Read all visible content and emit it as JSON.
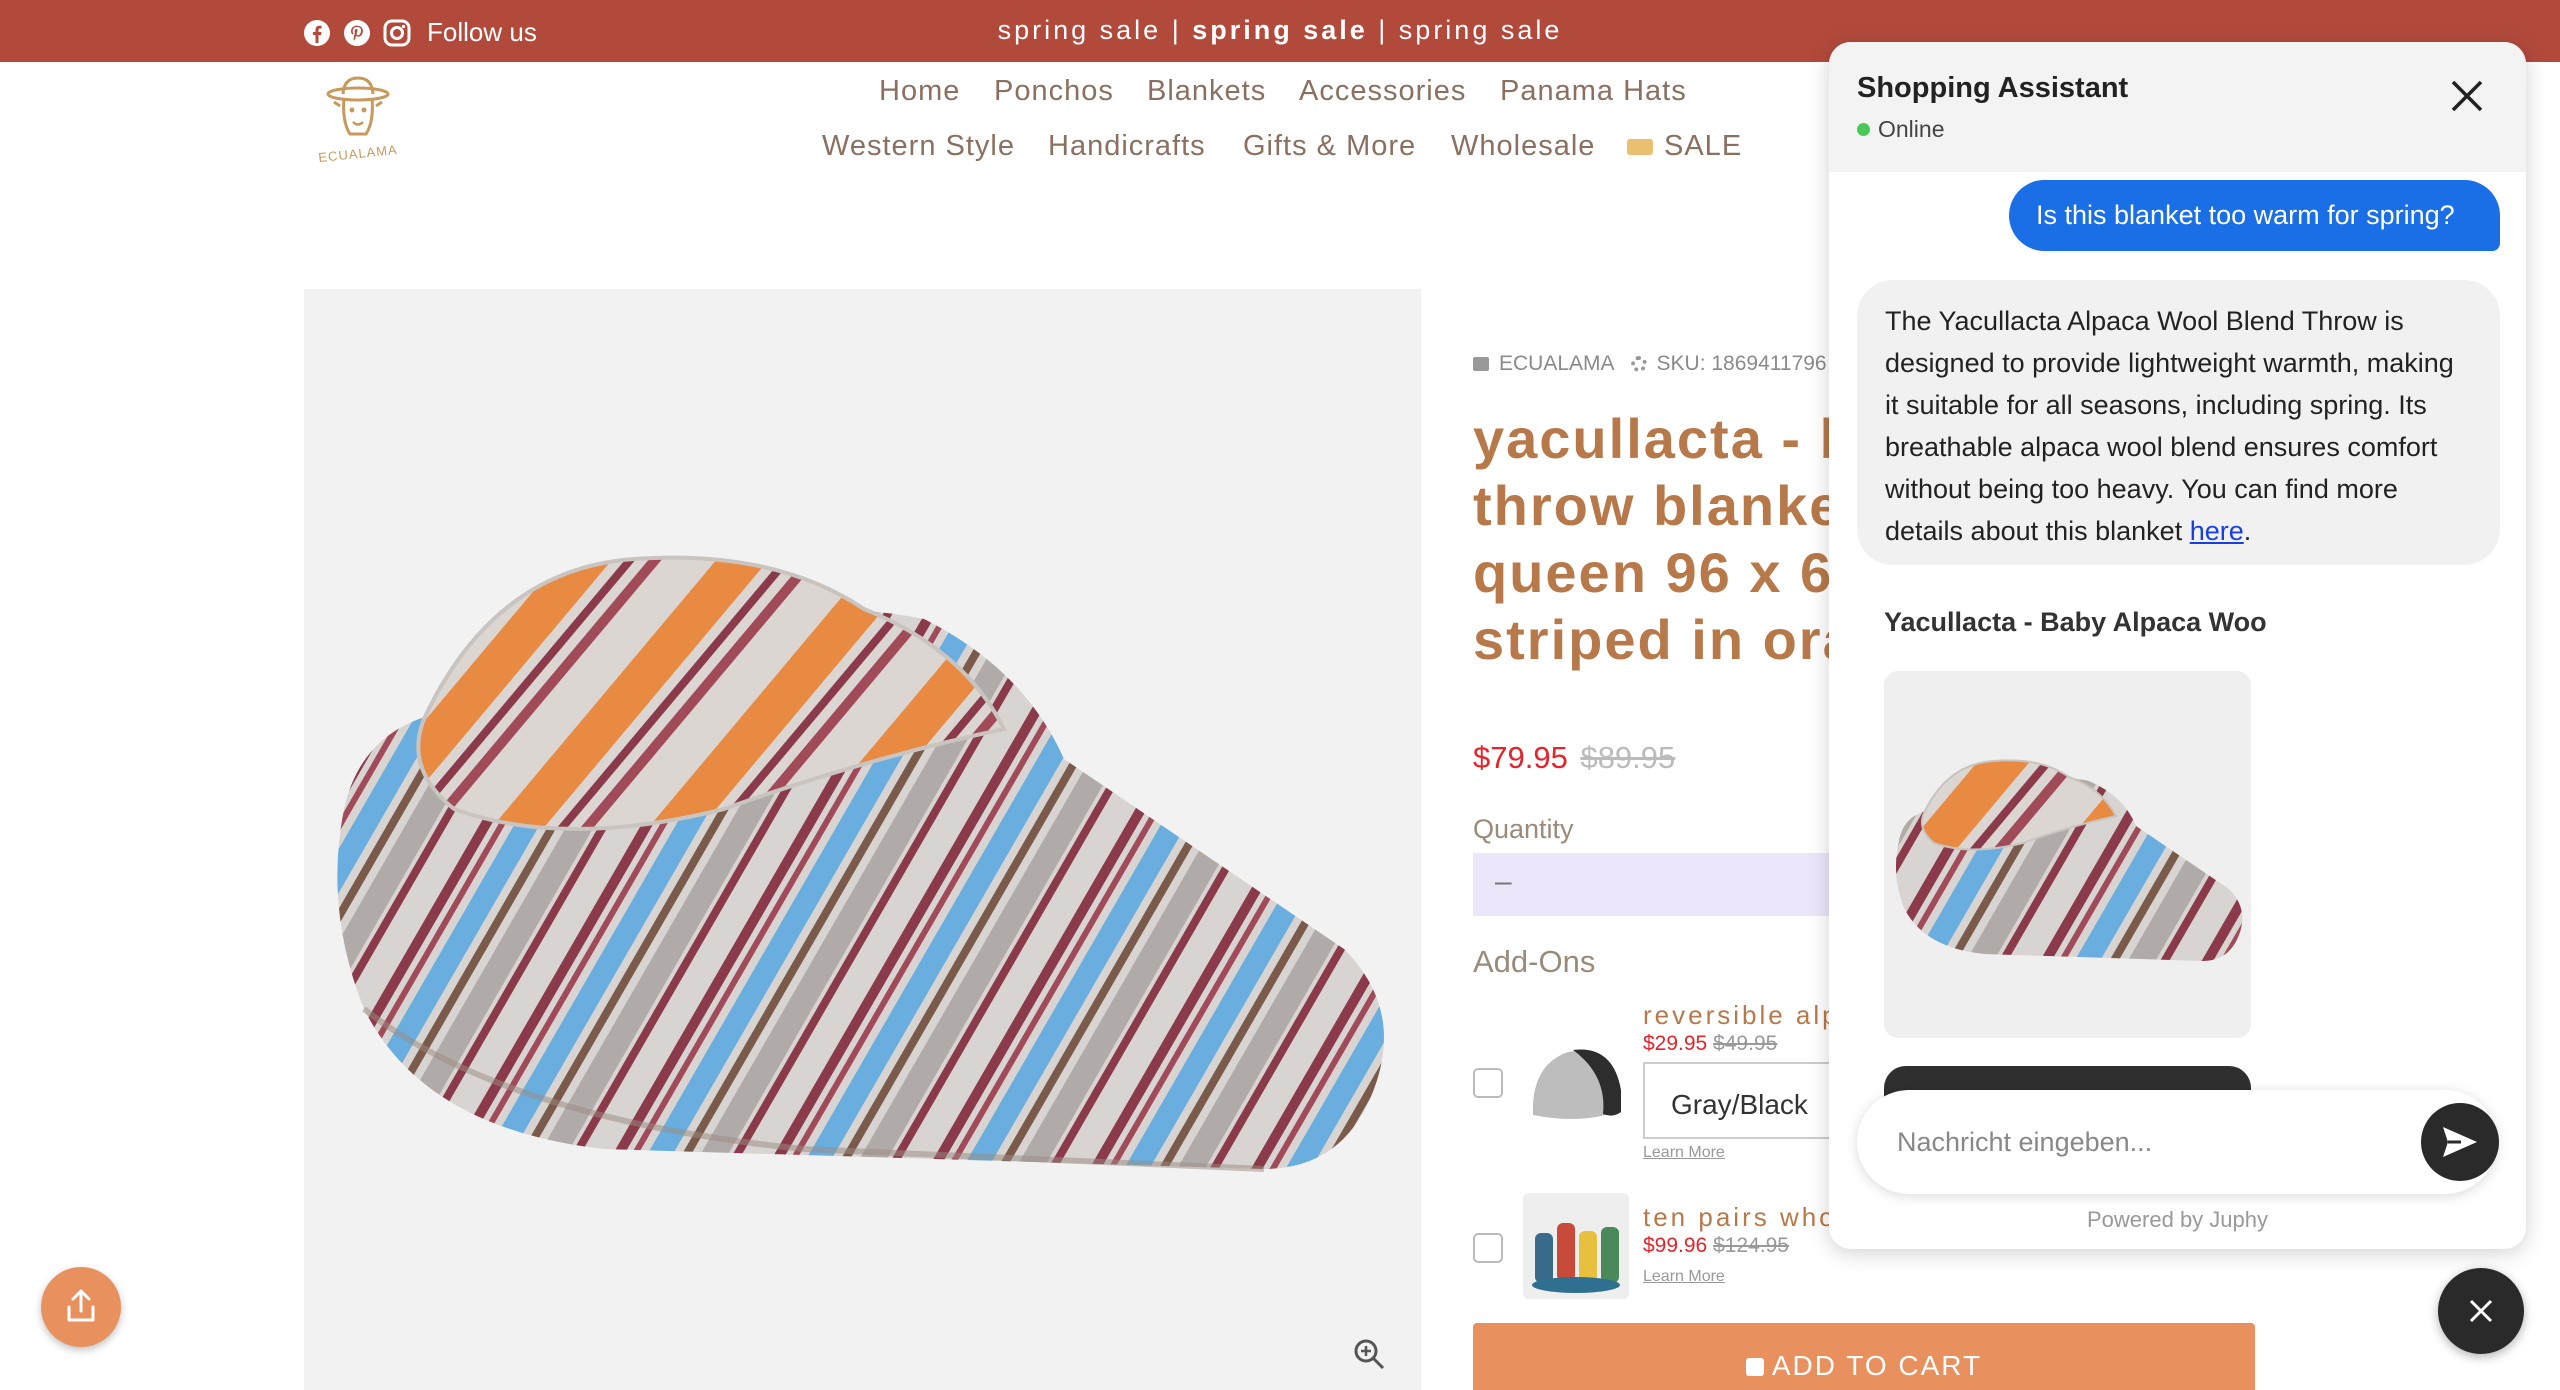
{
  "announcement": {
    "follow_label": "Follow us",
    "social_icons": [
      "facebook-icon",
      "pinterest-icon",
      "instagram-icon"
    ],
    "promo_part1": "spring sale | ",
    "promo_bold": "spring sale",
    "promo_part3": " | spring sale",
    "bg_color": "#b24a3c"
  },
  "logo": {
    "text": "ECUALAMA"
  },
  "nav": {
    "row1": [
      "Home",
      "Ponchos",
      "Blankets",
      "Accessories",
      "Panama Hats"
    ],
    "row2": [
      "Western Style",
      "Handicrafts",
      "Gifts & More",
      "Wholesale",
      "SALE"
    ]
  },
  "product": {
    "vendor": "ECUALAMA",
    "sku_label": "SKU: 1869411796",
    "title_lines": [
      "yacullacta - b",
      "throw blanket",
      "queen 96 x 6",
      "striped in oran"
    ],
    "price": "$79.95",
    "compare_price": "$89.95",
    "quantity_label": "Quantity",
    "qty_minus": "–",
    "addons_label": "Add-Ons",
    "addons": [
      {
        "name": "reversible alpa",
        "price": "$29.95",
        "compare": "$49.95",
        "variant": "Gray/Black",
        "learn": "Learn More"
      },
      {
        "name": "ten pairs whol",
        "price": "$99.96",
        "compare": "$124.95",
        "learn": "Learn More"
      }
    ],
    "add_to_cart": "ADD TO CART",
    "price_color": "#e3242b",
    "accent_color": "#e8915f"
  },
  "chat": {
    "title": "Shopping Assistant",
    "status": "Online",
    "user_message": "Is this blanket too warm for spring?",
    "bot_message": "The Yacullacta Alpaca Wool Blend Throw is designed to provide lightweight warmth, making it suitable for all seasons, including spring. Its breathable alpaca wool blend ensures comfort without being too heavy. You can find more details about this blanket ",
    "bot_link": "here",
    "bot_end": ".",
    "card_title": "Yacullacta - Baby Alpaca Woo",
    "input_placeholder": "Nachricht eingeben...",
    "powered_by": "Powered by Juphy",
    "user_bubble_color": "#1a6ee6"
  }
}
